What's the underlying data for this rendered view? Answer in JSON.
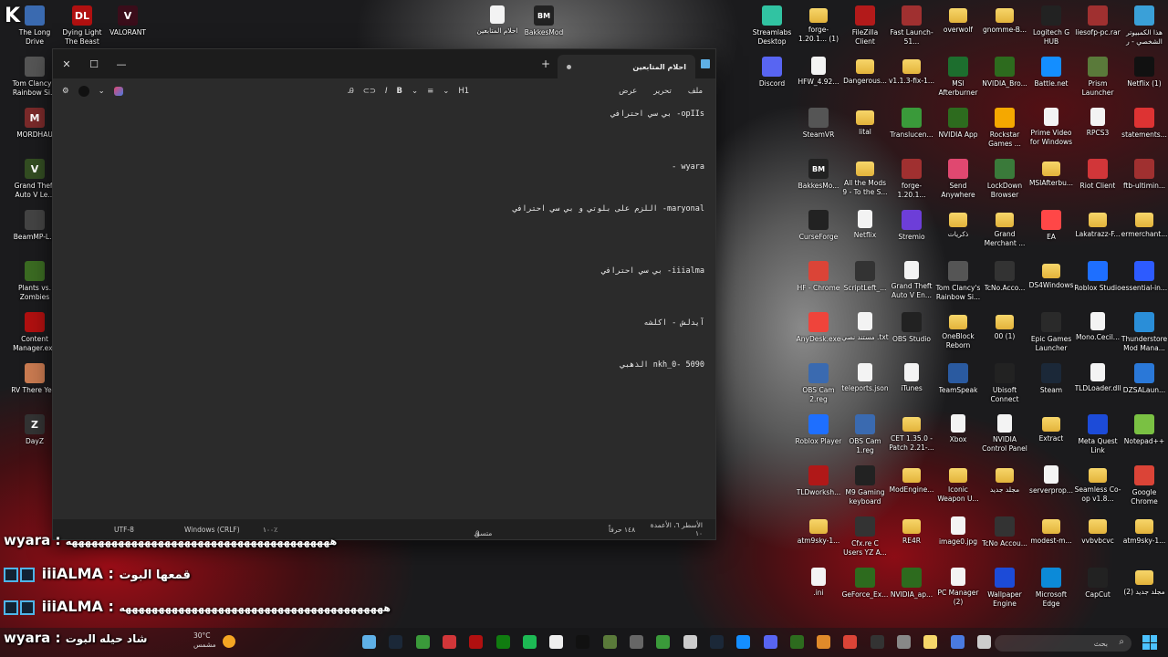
{
  "overlay_logo": "K 6",
  "desktop_left": [
    {
      "label": "The Long Drive",
      "color": "#3a6ab0",
      "glyph": ""
    },
    {
      "label": "Dying Light The Beast",
      "color": "#b01010",
      "glyph": "DL"
    },
    {
      "label": "VALORANT",
      "color": "#3a0d1a",
      "glyph": "V"
    },
    {
      "label": "Tom Clancy's Rainbow Si...",
      "color": "#555",
      "glyph": ""
    },
    {
      "label": "MORDHAU",
      "color": "#7a2a2a",
      "glyph": "M"
    },
    {
      "label": "Grand Theft Auto V Le...",
      "color": "#334d22",
      "glyph": "V"
    },
    {
      "label": "BeamMP-L...",
      "color": "#444",
      "glyph": ""
    },
    {
      "label": "Plants vs. Zombies",
      "color": "#3b6b22",
      "glyph": ""
    },
    {
      "label": "Content Manager.exe",
      "color": "#b01010",
      "glyph": ""
    },
    {
      "label": "RV There Ye...",
      "color": "#c97a50",
      "glyph": ""
    },
    {
      "label": "DayZ",
      "color": "#333",
      "glyph": "Z"
    }
  ],
  "desktop_top": [
    {
      "label": "احلام المتابعين",
      "kind": "file"
    },
    {
      "label": "BakkesMod",
      "kind": "bm"
    }
  ],
  "desktop_grid": [
    [
      {
        "label": "Streamlabs Desktop",
        "kind": "app",
        "color": "#31c3a2"
      },
      {
        "label": "forge-1.20.1... (1)",
        "kind": "folder"
      },
      {
        "label": "FileZilla Client",
        "kind": "app",
        "color": "#b31a1a"
      },
      {
        "label": "Fast Launch-51...",
        "kind": "app",
        "color": "#a03030"
      },
      {
        "label": "overwolf",
        "kind": "folder"
      },
      {
        "label": "gnomme-B...",
        "kind": "folder"
      },
      {
        "label": "Logitech G HUB",
        "kind": "app",
        "color": "#222"
      },
      {
        "label": "liesofp-pc.rar",
        "kind": "app",
        "color": "#a03030"
      },
      {
        "label": "هذا الكمبيوتر الشخصي - ر",
        "kind": "app",
        "color": "#3aa0d8"
      }
    ],
    [
      {
        "label": "Discord",
        "kind": "app",
        "color": "#5865f2"
      },
      {
        "label": "HFW_4.92...",
        "kind": "file"
      },
      {
        "label": "Dangerous...",
        "kind": "folder"
      },
      {
        "label": "v1.1.3-fix-1...",
        "kind": "folder"
      },
      {
        "label": "MSI Afterburner",
        "kind": "app",
        "color": "#1d6e2e"
      },
      {
        "label": "NVIDIA_Bro...",
        "kind": "app",
        "color": "#2d6b1e"
      },
      {
        "label": "Battle.net",
        "kind": "app",
        "color": "#148eff"
      },
      {
        "label": "Prism Launcher",
        "kind": "app",
        "color": "#5a7a3a"
      },
      {
        "label": "Netflix (1)",
        "kind": "app",
        "color": "#111"
      }
    ],
    [
      {
        "label": "SteamVR",
        "kind": "app",
        "color": "#555"
      },
      {
        "label": "lital",
        "kind": "folder"
      },
      {
        "label": "Translucen...",
        "kind": "app",
        "color": "#3a9a3a"
      },
      {
        "label": "NVIDIA App",
        "kind": "app",
        "color": "#2d6b1e"
      },
      {
        "label": "Rockstar Games ...",
        "kind": "app",
        "color": "#f5a800"
      },
      {
        "label": "Prime Video for Windows",
        "kind": "file"
      },
      {
        "label": "RPCS3",
        "kind": "file"
      },
      {
        "label": "statements...",
        "kind": "app",
        "color": "#d33"
      }
    ],
    [
      {
        "label": "BakkesMo...",
        "kind": "bm"
      },
      {
        "label": "All the Mods 9 - To the S...",
        "kind": "folder"
      },
      {
        "label": "forge-1.20.1... (1).jar",
        "kind": "app",
        "color": "#a03030"
      },
      {
        "label": "Send Anywhere",
        "kind": "app",
        "color": "#e04870"
      },
      {
        "label": "LockDown Browser",
        "kind": "app",
        "color": "#3a7a3a"
      },
      {
        "label": "MSIAfterbu...",
        "kind": "folder"
      },
      {
        "label": "Riot Client",
        "kind": "app",
        "color": "#d13639"
      },
      {
        "label": "ftb-ultimin...",
        "kind": "app",
        "color": "#a03030"
      }
    ],
    [
      {
        "label": "CurseForge",
        "kind": "app",
        "color": "#222"
      },
      {
        "label": "Netflix",
        "kind": "file"
      },
      {
        "label": "Stremio",
        "kind": "app",
        "color": "#6d3ed8"
      },
      {
        "label": "ذكريات",
        "kind": "folder"
      },
      {
        "label": "Grand Merchant ...",
        "kind": "folder"
      },
      {
        "label": "EA",
        "kind": "app",
        "color": "#ff4747"
      },
      {
        "label": "Lakatrazz-F...",
        "kind": "folder"
      },
      {
        "label": "ermerchant...",
        "kind": "folder"
      }
    ],
    [
      {
        "label": "HF - Chrome",
        "kind": "app",
        "color": "#db4437"
      },
      {
        "label": "ScriptLeft_...",
        "kind": "app",
        "color": "#333"
      },
      {
        "label": "Grand Theft Auto V En...",
        "kind": "file"
      },
      {
        "label": "Tom Clancy's Rainbow Si...",
        "kind": "app",
        "color": "#555"
      },
      {
        "label": "TcNo.Acco...",
        "kind": "app",
        "color": "#333"
      },
      {
        "label": "DS4Windows",
        "kind": "folder"
      },
      {
        "label": "Roblox Studio",
        "kind": "app",
        "color": "#1e6fff"
      },
      {
        "label": "essential-in...",
        "kind": "app",
        "color": "#2d5bff"
      }
    ],
    [
      {
        "label": "AnyDesk.exe",
        "kind": "app",
        "color": "#ef443b"
      },
      {
        "label": "مستند نصي .txt",
        "kind": "file"
      },
      {
        "label": "OBS Studio",
        "kind": "app",
        "color": "#222"
      },
      {
        "label": "OneBlock Reborn 1.19.X",
        "kind": "folder"
      },
      {
        "label": "00 (1)",
        "kind": "folder"
      },
      {
        "label": "Epic Games Launcher",
        "kind": "app",
        "color": "#2a2a2a"
      },
      {
        "label": "Mono.Cecil...",
        "kind": "file"
      },
      {
        "label": "Thunderstore Mod Mana...",
        "kind": "app",
        "color": "#2a8ed8"
      }
    ],
    [
      {
        "label": "OBS Cam 2.reg",
        "kind": "app",
        "color": "#3a6ab0"
      },
      {
        "label": "teleports.json",
        "kind": "file"
      },
      {
        "label": "iTunes",
        "kind": "file"
      },
      {
        "label": "TeamSpeak",
        "kind": "app",
        "color": "#2a5aa0"
      },
      {
        "label": "Ubisoft Connect",
        "kind": "app",
        "color": "#222"
      },
      {
        "label": "Steam",
        "kind": "app",
        "color": "#1b2838"
      },
      {
        "label": "TLDLoader.dll",
        "kind": "file"
      },
      {
        "label": "DZSALaun...",
        "kind": "app",
        "color": "#2a78d8"
      }
    ],
    [
      {
        "label": "Roblox Player",
        "kind": "app",
        "color": "#1e6fff"
      },
      {
        "label": "OBS Cam 1.reg",
        "kind": "app",
        "color": "#3a6ab0"
      },
      {
        "label": "CET 1.35.0 - Patch 2.21-...",
        "kind": "folder"
      },
      {
        "label": "Xbox",
        "kind": "file"
      },
      {
        "label": "NVIDIA Control Panel",
        "kind": "file"
      },
      {
        "label": "Extract",
        "kind": "folder"
      },
      {
        "label": "Meta Quest Link",
        "kind": "app",
        "color": "#1c4bd8"
      },
      {
        "label": "Notepad++",
        "kind": "app",
        "color": "#7ac143"
      }
    ],
    [
      {
        "label": "TLDworksh...",
        "kind": "app",
        "color": "#b01818"
      },
      {
        "label": "M9 Gaming keyboard",
        "kind": "app",
        "color": "#222"
      },
      {
        "label": "ModEngine...",
        "kind": "folder"
      },
      {
        "label": "Iconic Weapon U...",
        "kind": "folder"
      },
      {
        "label": "مجلد جديد",
        "kind": "folder"
      },
      {
        "label": "serverprop...",
        "kind": "file"
      },
      {
        "label": "Seamless Co-op v1.8...",
        "kind": "folder"
      },
      {
        "label": "Google Chrome",
        "kind": "app",
        "color": "#db4437"
      }
    ],
    [
      {
        "label": "atm9sky-1...",
        "kind": "folder"
      },
      {
        "label": "Cfx.re C Users YZ A...",
        "kind": "app",
        "color": "#333"
      },
      {
        "label": "RE4R",
        "kind": "folder"
      },
      {
        "label": "image0.jpg",
        "kind": "file"
      },
      {
        "label": "TcNo Accou...",
        "kind": "app",
        "color": "#333"
      },
      {
        "label": "modest-m...",
        "kind": "folder"
      },
      {
        "label": "vvbvbcvc",
        "kind": "folder"
      },
      {
        "label": "atm9sky-1...",
        "kind": "folder"
      }
    ],
    [
      {
        "label": ".ini",
        "kind": "file"
      },
      {
        "label": "GeForce_Ex...",
        "kind": "app",
        "color": "#2d6b1e"
      },
      {
        "label": "NVIDIA_ap...",
        "kind": "app",
        "color": "#2d6b1e"
      },
      {
        "label": "PC Manager (2)",
        "kind": "file"
      },
      {
        "label": "Wallpaper Engine",
        "kind": "app",
        "color": "#1c4bd8"
      },
      {
        "label": "Microsoft Edge",
        "kind": "app",
        "color": "#0c8ad8"
      },
      {
        "label": "CapCut",
        "kind": "app",
        "color": "#222"
      },
      {
        "label": "مجلد جديد (2)",
        "kind": "folder"
      }
    ]
  ],
  "notepad": {
    "tab_title": "احلام المتابعين",
    "new_tab": "+",
    "menus": [
      "ملف",
      "تحرير",
      "عرض"
    ],
    "heading_btn": "H1",
    "bold_btn": "B",
    "italic_btn": "I",
    "list_btn": "≡",
    "lines": [
      "opIIs- بي سي احترافي",
      "wyara -",
      "maryonal- اللزم على بلوتي و بي سي احترافي",
      "iiialma- بي سي احترافي",
      "آيدلش - اكلشه",
      "nkh_0- 5090 الذهبي"
    ],
    "status": {
      "position": "الأسطر ٦، الأعمدة ١٠",
      "chars": "١٤٨ حرفاً",
      "format": "متسق",
      "zoom": "١٠٠٪",
      "eol": "Windows (CRLF)",
      "encoding": "UTF-8"
    }
  },
  "chat": [
    {
      "user": "wyara",
      "text": "ههههههههههههههههههههههههههههههههههههههههه",
      "color": "#ffffff"
    },
    {
      "user": "iiiALMA",
      "text": "قمعها البوت",
      "color": "#ffffff"
    },
    {
      "user": "iiiALMA",
      "text": "ههههههههههههههههههههههههههههههههههههههههه",
      "color": "#ffffff"
    },
    {
      "user": "wyara",
      "text": "شاد حيله البوت",
      "color": "#ffffff"
    }
  ],
  "taskbar": {
    "weather_temp": "30°C",
    "weather_desc": "مشمس",
    "search_placeholder": "بحث"
  }
}
